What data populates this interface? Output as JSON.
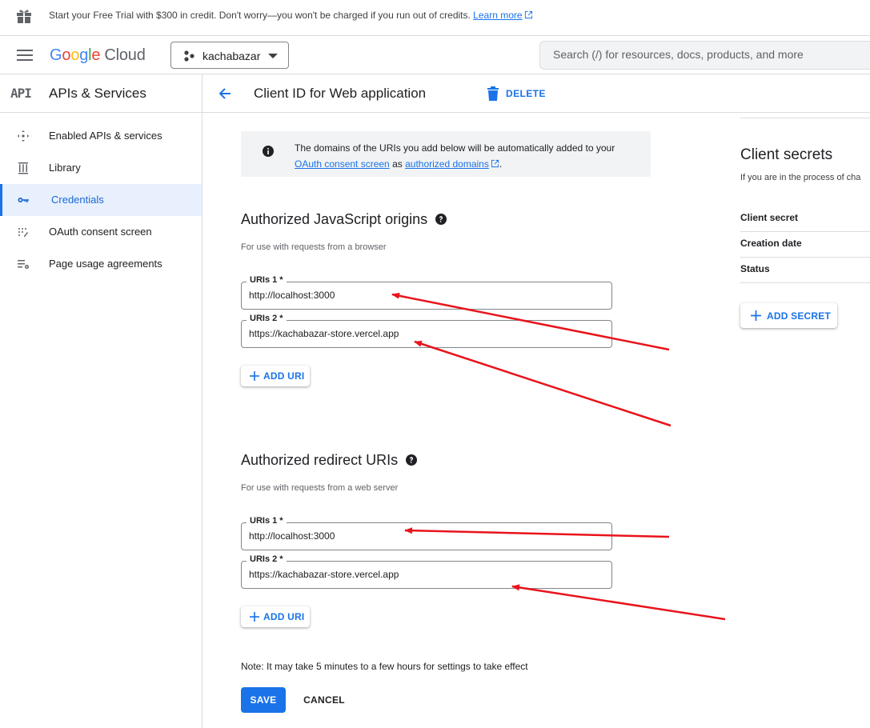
{
  "promo": {
    "text": "Start your Free Trial with $300 in credit. Don't worry—you won't be charged if you run out of credits.",
    "link": "Learn more"
  },
  "header": {
    "logo_letters": [
      "G",
      "o",
      "o",
      "g",
      "l",
      "e"
    ],
    "logo_suffix": "Cloud",
    "project": "kachabazar",
    "search_placeholder": "Search (/) for resources, docs, products, and more"
  },
  "sidebar": {
    "badge": "API",
    "title": "APIs & Services",
    "items": [
      {
        "label": "Enabled APIs & services",
        "icon": "enabled-apis-icon"
      },
      {
        "label": "Library",
        "icon": "library-icon"
      },
      {
        "label": "Credentials",
        "icon": "key-icon",
        "active": true
      },
      {
        "label": "OAuth consent screen",
        "icon": "oauth-consent-icon"
      },
      {
        "label": "Page usage agreements",
        "icon": "page-usage-icon"
      }
    ]
  },
  "page": {
    "title": "Client ID for Web application",
    "delete_label": "DELETE"
  },
  "info": {
    "text_before": "The domains of the URIs you add below will be automatically added to your",
    "link1": "OAuth consent screen",
    "text_mid": "as",
    "link2": "authorized domains"
  },
  "js_origins": {
    "title": "Authorized JavaScript origins",
    "hint": "For use with requests from a browser",
    "uris": [
      {
        "label": "URIs 1 *",
        "value": "http://localhost:3000"
      },
      {
        "label": "URIs 2 *",
        "value": "https://kachabazar-store.vercel.app"
      }
    ],
    "add_label": "ADD URI"
  },
  "redirect": {
    "title": "Authorized redirect URIs",
    "hint": "For use with requests from a web server",
    "uris": [
      {
        "label": "URIs 1 *",
        "value": "http://localhost:3000"
      },
      {
        "label": "URIs 2 *",
        "value": "https://kachabazar-store.vercel.app"
      }
    ],
    "add_label": "ADD URI"
  },
  "footer": {
    "note": "Note: It may take 5 minutes to a few hours for settings to take effect",
    "save": "SAVE",
    "cancel": "CANCEL"
  },
  "secrets": {
    "title": "Client secrets",
    "desc": "If you are in the process of cha",
    "rows": [
      "Client secret",
      "Creation date",
      "Status"
    ],
    "add_label": "ADD SECRET"
  },
  "colors": {
    "accent": "#1a73e8",
    "annotation_arrow": "#e8141b",
    "active_bg": "#e8f0fe"
  }
}
